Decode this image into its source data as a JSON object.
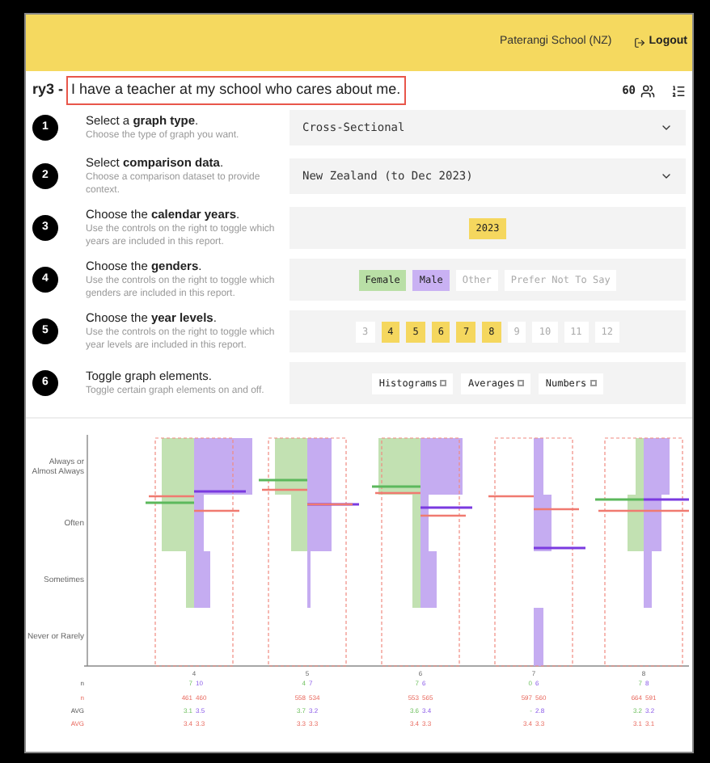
{
  "header": {
    "school": "Paterangi School (NZ)",
    "logout": "Logout"
  },
  "title": {
    "code": "ry3 -",
    "question": "I have a teacher at my school who cares about me.",
    "count": "60"
  },
  "steps": [
    {
      "number": "1",
      "title": "Select a **graph type**.",
      "description": "Choose the type of graph you want.",
      "kind": "select",
      "value": "Cross-Sectional"
    },
    {
      "number": "2",
      "title": "Select **comparison data**.",
      "description": "Choose a comparison dataset to provide context.",
      "kind": "select",
      "value": "New Zealand (to Dec 2023)"
    },
    {
      "number": "3",
      "title": "Choose the **calendar years**.",
      "description": "Use the controls on the right to toggle which years are included in this report.",
      "kind": "toggles",
      "options": [
        {
          "label": "2023",
          "selected": true,
          "color": "#f5d75e"
        }
      ]
    },
    {
      "number": "4",
      "title": "Choose the **genders**.",
      "description": "Use the controls on the right to toggle which genders are included in this report.",
      "kind": "toggles",
      "options": [
        {
          "label": "Female",
          "selected": true,
          "color": "#b9dfa6"
        },
        {
          "label": "Male",
          "selected": true,
          "color": "#c9b1f3"
        },
        {
          "label": "Other",
          "selected": false
        },
        {
          "label": "Prefer Not To Say",
          "selected": false
        }
      ]
    },
    {
      "number": "5",
      "title": "Choose the **year levels**.",
      "description": "Use the controls on the right to toggle which year levels are included in this report.",
      "kind": "toggles",
      "options": [
        {
          "label": "3",
          "selected": false
        },
        {
          "label": "4",
          "selected": true,
          "color": "#f5d75e"
        },
        {
          "label": "5",
          "selected": true,
          "color": "#f5d75e"
        },
        {
          "label": "6",
          "selected": true,
          "color": "#f5d75e"
        },
        {
          "label": "7",
          "selected": true,
          "color": "#f5d75e"
        },
        {
          "label": "8",
          "selected": true,
          "color": "#f5d75e"
        },
        {
          "label": "9",
          "selected": false
        },
        {
          "label": "10",
          "selected": false
        },
        {
          "label": "11",
          "selected": false
        },
        {
          "label": "12",
          "selected": false
        }
      ]
    },
    {
      "number": "6",
      "title": "Toggle graph elements.",
      "description": "Toggle certain graph elements on and off.",
      "kind": "checks",
      "options": [
        {
          "label": "Histograms",
          "checked": false
        },
        {
          "label": "Averages",
          "checked": false
        },
        {
          "label": "Numbers",
          "checked": false
        }
      ]
    }
  ],
  "graph": {
    "y_labels": [
      "Always or Almost Always",
      "Often",
      "Sometimes",
      "Never or Rarely"
    ],
    "row_labels": [
      "n",
      "n",
      "AVG",
      "AVG"
    ],
    "columns": [
      {
        "label": "4",
        "stats": [
          [
            "7",
            "10"
          ],
          [
            "461",
            "460"
          ],
          [
            "3.1",
            "3.5"
          ],
          [
            "3.4",
            "3.3"
          ]
        ]
      },
      {
        "label": "5",
        "stats": [
          [
            "4",
            "7"
          ],
          [
            "558",
            "534"
          ],
          [
            "3.7",
            "3.2"
          ],
          [
            "3.3",
            "3.3"
          ]
        ]
      },
      {
        "label": "6",
        "stats": [
          [
            "7",
            "6"
          ],
          [
            "553",
            "565"
          ],
          [
            "3.6",
            "3.4"
          ],
          [
            "3.4",
            "3.3"
          ]
        ]
      },
      {
        "label": "7",
        "stats": [
          [
            "0",
            "6"
          ],
          [
            "597",
            "560"
          ],
          [
            "-",
            "2.8"
          ],
          [
            "3.4",
            "3.3"
          ]
        ]
      },
      {
        "label": "8",
        "stats": [
          [
            "7",
            "8"
          ],
          [
            "664",
            "591"
          ],
          [
            "3.2",
            "3.2"
          ],
          [
            "3.1",
            "3.1"
          ]
        ]
      }
    ]
  }
}
